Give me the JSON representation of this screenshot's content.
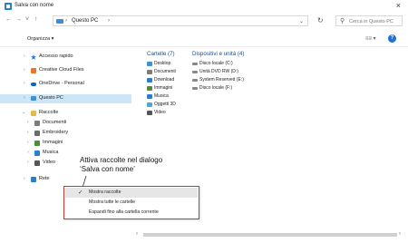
{
  "window": {
    "title": "Salva con nome",
    "close_glyph": "×"
  },
  "nav": {
    "back_glyph": "←",
    "forward_glyph": "→",
    "recent_glyph": "˅",
    "up_glyph": "↑",
    "breadcrumb": [
      "Questo PC"
    ],
    "breadcrumb_sep": "›",
    "address_dropdown_glyph": "⌄",
    "refresh_glyph": "↻",
    "search_placeholder": "Cerca in Questo PC",
    "search_glyph": "⚲"
  },
  "command_bar": {
    "organize_label": "Organizza ▾",
    "view_label": "≡≡ ▾",
    "help_label": "?"
  },
  "nav_pane": {
    "items": [
      {
        "label": "Accesso rapido",
        "icon": "star-icon",
        "color": "#1e6fd9",
        "chevron": "›"
      },
      {
        "label": "Creative Cloud Files",
        "icon": "cloud-folder-icon",
        "color": "#e8762d",
        "chevron": "›"
      },
      {
        "label": "OneDrive - Personal",
        "icon": "onedrive-icon",
        "color": "#0a64c8",
        "chevron": "›"
      },
      {
        "label": "Questo PC",
        "icon": "computer-icon",
        "color": "#3c8fd8",
        "chevron": "›"
      },
      {
        "label": "Raccolte",
        "icon": "libraries-icon",
        "color": "#e6b94a",
        "chevron": "⌄"
      },
      {
        "label": "Documenti",
        "icon": "documents-icon",
        "color": "#7c7c7c",
        "chevron": "›"
      },
      {
        "label": "Embroidery",
        "icon": "library-icon",
        "color": "#6a6a6a",
        "chevron": "›"
      },
      {
        "label": "Immagini",
        "icon": "pictures-icon",
        "color": "#4e8c3a",
        "chevron": "›"
      },
      {
        "label": "Musica",
        "icon": "music-icon",
        "color": "#2b7cd3",
        "chevron": "›"
      },
      {
        "label": "Video",
        "icon": "video-icon",
        "color": "#555555",
        "chevron": "›"
      },
      {
        "label": "Rete",
        "icon": "network-icon",
        "color": "#2b7cd3",
        "chevron": "›"
      }
    ]
  },
  "content": {
    "folders_header": "Cartelle (7)",
    "drives_header": "Dispositivi e unità (4)",
    "folders": [
      {
        "label": "Desktop",
        "icon": "desktop-icon",
        "color": "#3c8fd8"
      },
      {
        "label": "Documenti",
        "icon": "documents-icon",
        "color": "#7c7c7c"
      },
      {
        "label": "Download",
        "icon": "download-icon",
        "color": "#2b7cd3"
      },
      {
        "label": "Immagini",
        "icon": "pictures-icon",
        "color": "#4e8c3a"
      },
      {
        "label": "Musica",
        "icon": "music-icon",
        "color": "#2b7cd3"
      },
      {
        "label": "Oggetti 3D",
        "icon": "objects3d-icon",
        "color": "#4aa8d8"
      },
      {
        "label": "Video",
        "icon": "video-icon",
        "color": "#555555"
      }
    ],
    "drives": [
      {
        "label": "Disco locale (C:)",
        "icon": "drive-icon",
        "color": "#888888"
      },
      {
        "label": "Unità DVD RW (D:)",
        "icon": "dvd-icon",
        "color": "#888888"
      },
      {
        "label": "System Reserved (E:)",
        "icon": "drive-icon",
        "color": "#888888"
      },
      {
        "label": "Disco locale (F:)",
        "icon": "drive-icon",
        "color": "#888888"
      }
    ]
  },
  "annotation": {
    "line1": "Attiva raccolte nel dialogo",
    "line2": "‘Salva con nome’"
  },
  "context_menu": {
    "items": [
      {
        "label": "Mostra raccolte",
        "checked": true,
        "check_glyph": "✓"
      },
      {
        "label": "Mostra tutte le cartelle",
        "checked": false,
        "check_glyph": ""
      },
      {
        "label": "Espandi fino alla cartella corrente",
        "checked": false,
        "check_glyph": ""
      }
    ],
    "border_color": "#c73a2d"
  },
  "scrollbar": {
    "left_glyph": "‹",
    "right_glyph": "›"
  }
}
